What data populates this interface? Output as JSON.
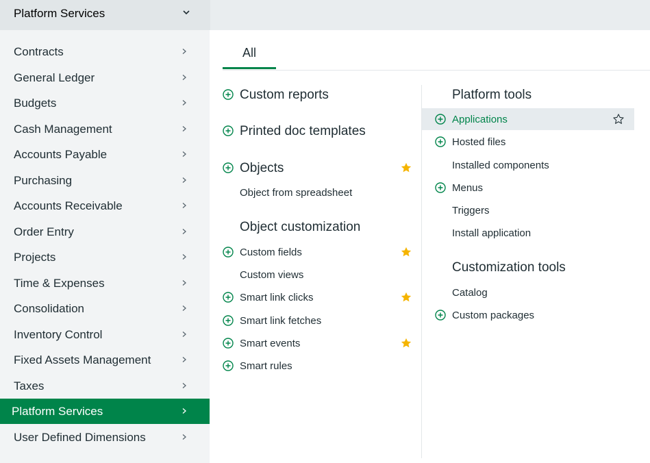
{
  "header": {
    "title": "Platform Services"
  },
  "sidebar": {
    "items": [
      {
        "label": "Contracts"
      },
      {
        "label": "General Ledger"
      },
      {
        "label": "Budgets"
      },
      {
        "label": "Cash Management"
      },
      {
        "label": "Accounts Payable"
      },
      {
        "label": "Purchasing"
      },
      {
        "label": "Accounts Receivable"
      },
      {
        "label": "Order Entry"
      },
      {
        "label": "Projects"
      },
      {
        "label": "Time & Expenses"
      },
      {
        "label": "Consolidation"
      },
      {
        "label": "Inventory Control"
      },
      {
        "label": "Fixed Assets Management"
      },
      {
        "label": "Taxes"
      },
      {
        "label": "Platform Services",
        "active": true
      },
      {
        "label": "User Defined Dimensions"
      }
    ]
  },
  "tabs": [
    {
      "label": "All",
      "active": true
    }
  ],
  "left_column": {
    "custom_reports": "Custom reports",
    "printed_doc_templates": "Printed doc templates",
    "objects": "Objects",
    "object_from_spreadsheet": "Object from spreadsheet",
    "object_customization_heading": "Object customization",
    "custom_fields": "Custom fields",
    "custom_views": "Custom views",
    "smart_link_clicks": "Smart link clicks",
    "smart_link_fetches": "Smart link fetches",
    "smart_events": "Smart events",
    "smart_rules": "Smart rules"
  },
  "right_column": {
    "platform_tools_heading": "Platform tools",
    "applications": "Applications",
    "hosted_files": "Hosted files",
    "installed_components": "Installed components",
    "menus": "Menus",
    "triggers": "Triggers",
    "install_application": "Install application",
    "customization_tools_heading": "Customization tools",
    "catalog": "Catalog",
    "custom_packages": "Custom packages"
  },
  "colors": {
    "accent": "#00844a",
    "star": "#f5b400"
  }
}
